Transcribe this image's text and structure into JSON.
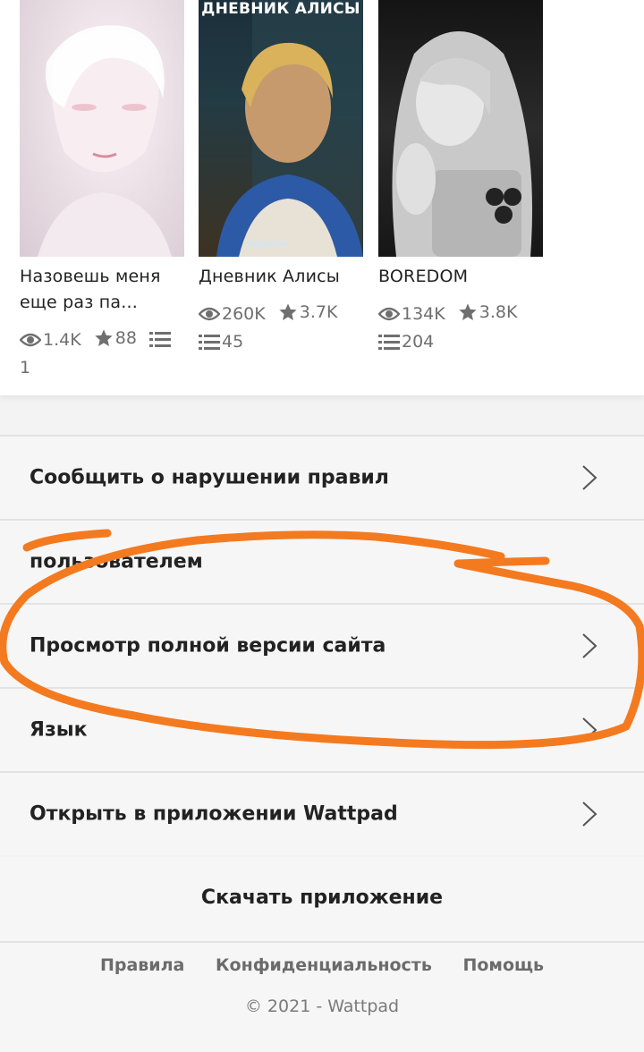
{
  "stories": [
    {
      "title": "Назовешь меня еще раз па...",
      "reads": "1.4K",
      "votes": "88",
      "parts": "1",
      "cover_text": ""
    },
    {
      "title": "Дневник Алисы",
      "reads": "260K",
      "votes": "3.7K",
      "parts": "45",
      "cover_text": "ДНЕВНИК АЛИСЫ",
      "cover_sub": "REDFISH"
    },
    {
      "title": "BOREDOM",
      "reads": "134K",
      "votes": "3.8K",
      "parts": "204",
      "cover_text": ""
    }
  ],
  "menu": [
    {
      "label": "Сообщить о нарушении правил"
    },
    {
      "label": "пользователем"
    },
    {
      "label": "Просмотр полной версии сайта"
    },
    {
      "label": "Язык"
    },
    {
      "label": "Открыть в приложении Wattpad"
    }
  ],
  "download_label": "Скачать приложение",
  "footer": {
    "links": [
      "Правила",
      "Конфиденциальность",
      "Помощь"
    ],
    "copyright": "© 2021 - Wattpad"
  },
  "colors": {
    "annotation": "#f47a20",
    "text": "#222222",
    "muted": "#6f6f6f"
  }
}
